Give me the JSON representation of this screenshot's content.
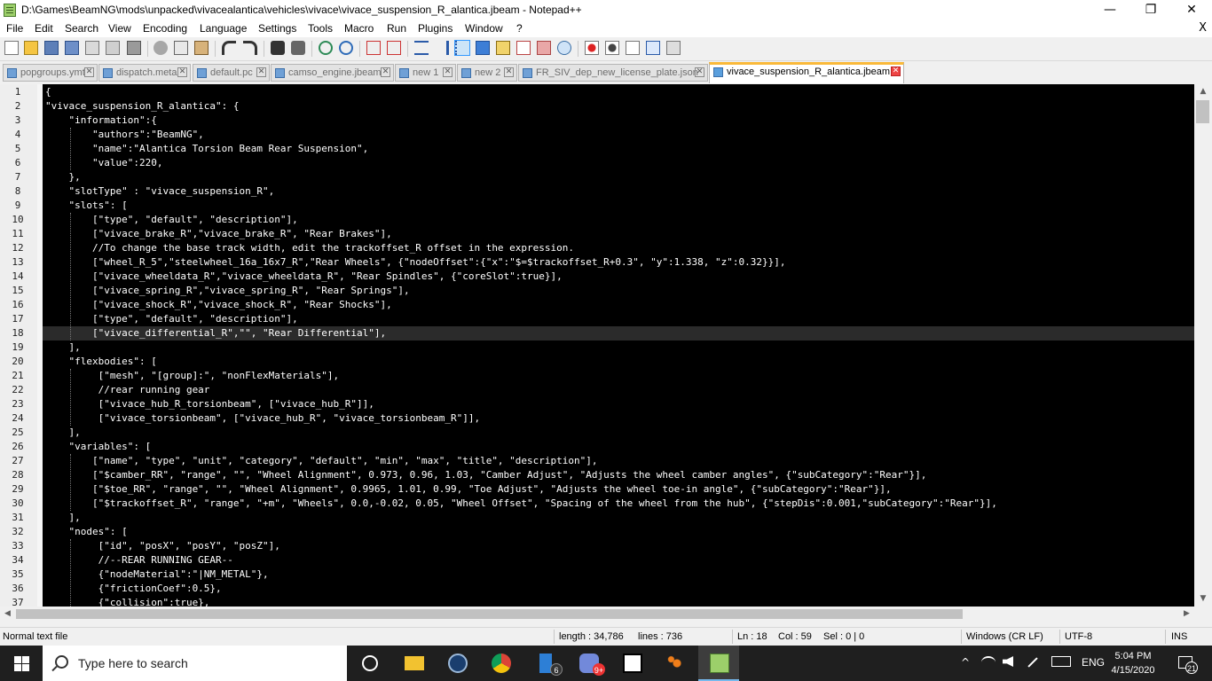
{
  "window": {
    "title": "D:\\Games\\BeamNG\\mods\\unpacked\\vivacealantica\\vehicles\\vivace\\vivace_suspension_R_alantica.jbeam - Notepad++",
    "minimize": "—",
    "maximize": "❐",
    "close": "✕"
  },
  "menu": {
    "items": [
      "File",
      "Edit",
      "Search",
      "View",
      "Encoding",
      "Language",
      "Settings",
      "Tools",
      "Macro",
      "Run",
      "Plugins",
      "Window",
      "?"
    ],
    "close_doc": "X"
  },
  "toolbar": {
    "icons": [
      "new-file-icon",
      "open-file-icon",
      "save-icon",
      "save-all-icon",
      "close-icon",
      "close-all-icon",
      "print-icon",
      "cut-icon",
      "copy-icon",
      "paste-icon",
      "undo-icon",
      "redo-icon",
      "find-icon",
      "replace-icon",
      "zoom-in-icon",
      "zoom-out-icon",
      "sync-vertical-icon",
      "sync-horizontal-icon",
      "word-wrap-icon",
      "show-all-characters-icon",
      "indent-guide-icon",
      "language-define-icon",
      "document-map-icon",
      "function-list-icon",
      "folder-as-workspace-icon",
      "monitoring-icon",
      "record-macro-icon",
      "stop-macro-icon",
      "playback-macro-icon",
      "run-macro-multiple-icon",
      "save-macro-icon"
    ]
  },
  "tabs": [
    {
      "label": "popgroups.ymt",
      "active": false
    },
    {
      "label": "dispatch.meta",
      "active": false
    },
    {
      "label": "default.pc",
      "active": false
    },
    {
      "label": "camso_engine.jbeam",
      "active": false
    },
    {
      "label": "new 1",
      "active": false
    },
    {
      "label": "new 2",
      "active": false
    },
    {
      "label": "FR_SIV_dep_new_license_plate.json",
      "active": false
    },
    {
      "label": "vivace_suspension_R_alantica.jbeam",
      "active": true
    }
  ],
  "tab_close": "✕",
  "editor": {
    "current_line": 18,
    "lines": [
      "{",
      "\"vivace_suspension_R_alantica\": {",
      "    \"information\":{",
      "        \"authors\":\"BeamNG\",",
      "        \"name\":\"Alantica Torsion Beam Rear Suspension\",",
      "        \"value\":220,",
      "    },",
      "    \"slotType\" : \"vivace_suspension_R\",",
      "    \"slots\": [",
      "        [\"type\", \"default\", \"description\"],",
      "        [\"vivace_brake_R\",\"vivace_brake_R\", \"Rear Brakes\"],",
      "        //To change the base track width, edit the trackoffset_R offset in the expression.",
      "        [\"wheel_R_5\",\"steelwheel_16a_16x7_R\",\"Rear Wheels\", {\"nodeOffset\":{\"x\":\"$=$trackoffset_R+0.3\", \"y\":1.338, \"z\":0.32}}],",
      "        [\"vivace_wheeldata_R\",\"vivace_wheeldata_R\", \"Rear Spindles\", {\"coreSlot\":true}],",
      "        [\"vivace_spring_R\",\"vivace_spring_R\", \"Rear Springs\"],",
      "        [\"vivace_shock_R\",\"vivace_shock_R\", \"Rear Shocks\"],",
      "        [\"type\", \"default\", \"description\"],",
      "        [\"vivace_differential_R\",\"\", \"Rear Differential\"],",
      "    ],",
      "    \"flexbodies\": [",
      "         [\"mesh\", \"[group]:\", \"nonFlexMaterials\"],",
      "         //rear running gear",
      "         [\"vivace_hub_R_torsionbeam\", [\"vivace_hub_R\"]],",
      "         [\"vivace_torsionbeam\", [\"vivace_hub_R\", \"vivace_torsionbeam_R\"]],",
      "    ],",
      "    \"variables\": [",
      "        [\"name\", \"type\", \"unit\", \"category\", \"default\", \"min\", \"max\", \"title\", \"description\"],",
      "        [\"$camber_RR\", \"range\", \"\", \"Wheel Alignment\", 0.973, 0.96, 1.03, \"Camber Adjust\", \"Adjusts the wheel camber angles\", {\"subCategory\":\"Rear\"}],",
      "        [\"$toe_RR\", \"range\", \"\", \"Wheel Alignment\", 0.9965, 1.01, 0.99, \"Toe Adjust\", \"Adjusts the wheel toe-in angle\", {\"subCategory\":\"Rear\"}],",
      "        [\"$trackoffset_R\", \"range\", \"+m\", \"Wheels\", 0.0,-0.02, 0.05, \"Wheel Offset\", \"Spacing of the wheel from the hub\", {\"stepDis\":0.001,\"subCategory\":\"Rear\"}],",
      "    ],",
      "    \"nodes\": [",
      "         [\"id\", \"posX\", \"posY\", \"posZ\"],",
      "         //--REAR RUNNING GEAR--",
      "         {\"nodeMaterial\":\"|NM_METAL\"},",
      "         {\"frictionCoef\":0.5},",
      "         {\"collision\":true},"
    ]
  },
  "scrollbars": {
    "up": "▲",
    "down": "▼",
    "left": "◀",
    "right": "▶"
  },
  "status": {
    "file_type": "Normal text file",
    "length": "length : 34,786",
    "lines": "lines : 736",
    "ln": "Ln : 18",
    "col": "Col : 59",
    "sel": "Sel : 0 | 0",
    "eol": "Windows (CR LF)",
    "encoding": "UTF-8",
    "mode": "INS"
  },
  "taskbar": {
    "search_placeholder": "Type here to search",
    "apps": [
      "task-view-icon",
      "file-explorer-icon",
      "steam-icon",
      "chrome-icon",
      "phone-app-icon",
      "discord-icon",
      "7zip-icon",
      "app-icon",
      "notepadpp-icon"
    ],
    "phone_badge": "6",
    "discord_badge": "9+",
    "language": "ENG",
    "time": "5:04 PM",
    "date": "4/15/2020",
    "notifications": "21"
  },
  "colors": {
    "editor_bg": "#000000",
    "active_tab_accent": "#fab93a",
    "taskbar": "#1f1f1f"
  }
}
